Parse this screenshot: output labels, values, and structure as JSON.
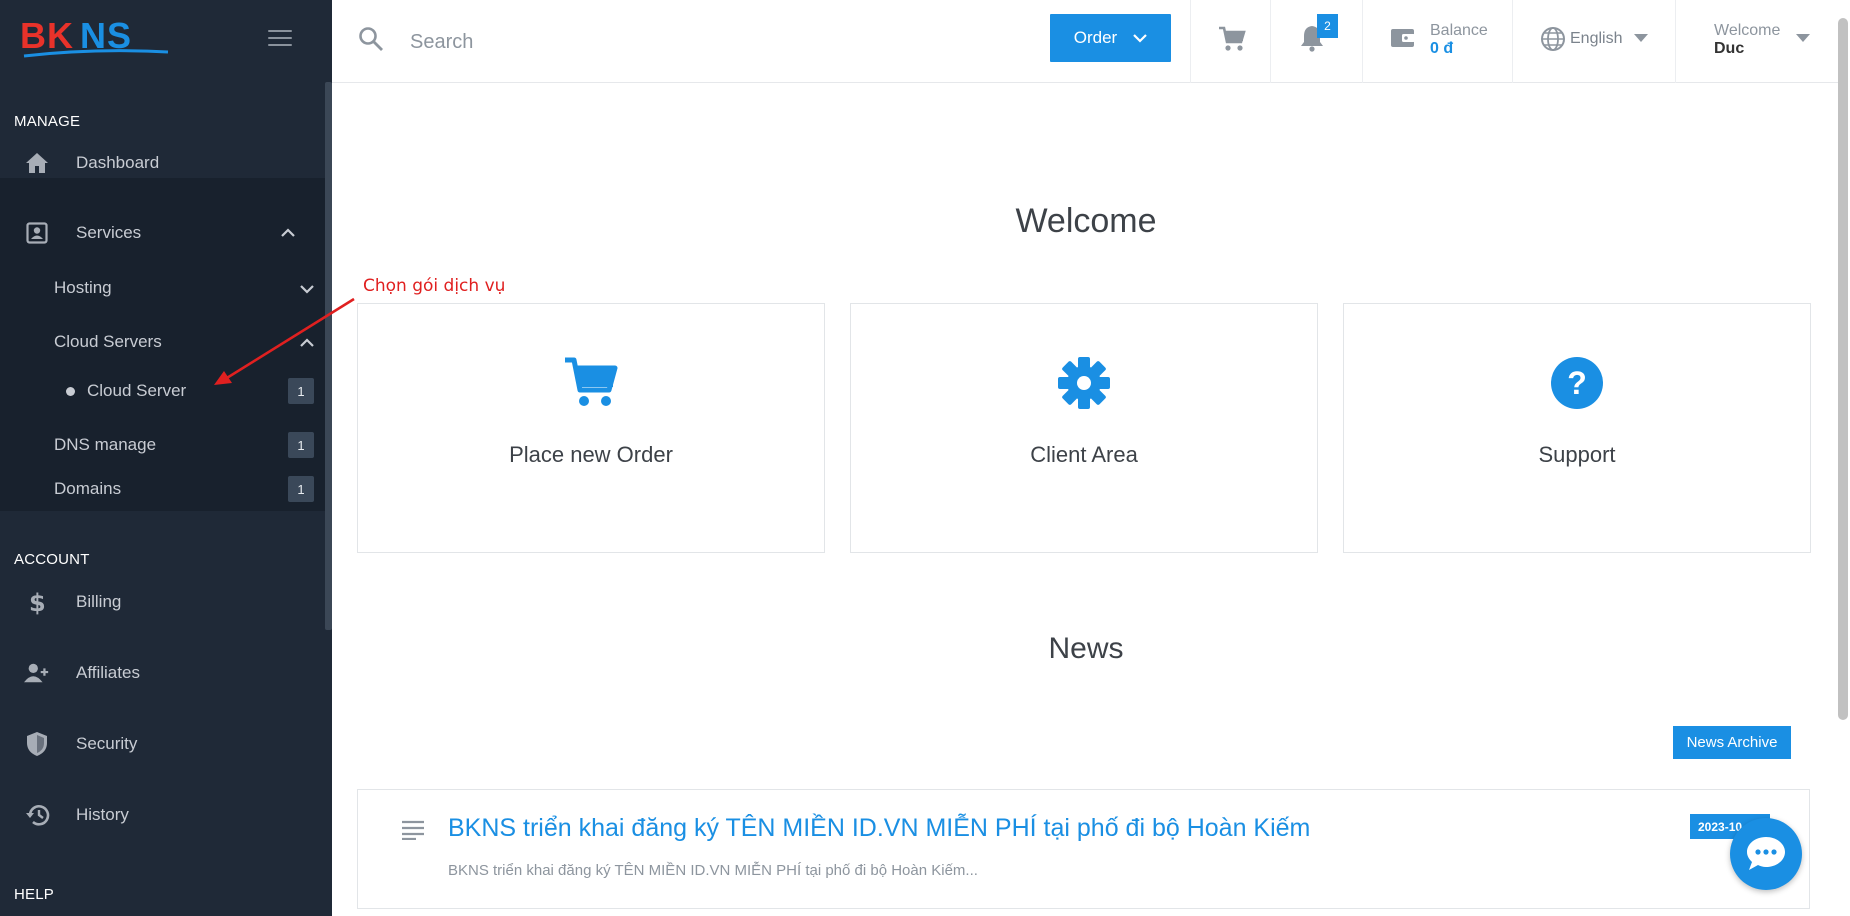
{
  "brand": {
    "logo_text": "BKNS"
  },
  "sidebar": {
    "sections": {
      "manage": "MANAGE",
      "account": "ACCOUNT",
      "help": "HELP"
    },
    "manage_items": {
      "dashboard": "Dashboard",
      "services": "Services"
    },
    "services_sub": {
      "hosting": "Hosting",
      "cloud_servers": "Cloud Servers",
      "cloud_server": "Cloud Server",
      "cloud_server_count": "1",
      "dns_manage": "DNS manage",
      "dns_manage_count": "1",
      "domains": "Domains",
      "domains_count": "1"
    },
    "account_items": {
      "billing": "Billing",
      "affiliates": "Affiliates",
      "security": "Security",
      "history": "History"
    }
  },
  "topbar": {
    "search_placeholder": "Search",
    "order_label": "Order",
    "notification_count": "2",
    "balance_label": "Balance",
    "balance_value": "0 đ",
    "language": "English",
    "welcome_label": "Welcome",
    "user_name": "Duc"
  },
  "main": {
    "welcome_heading": "Welcome",
    "cards": {
      "order": "Place new Order",
      "client_area": "Client Area",
      "support": "Support"
    },
    "news_heading": "News",
    "news_archive_label": "News Archive",
    "news_item": {
      "title": "BKNS triển khai đăng ký TÊN MIỀN ID.VN MIỄN PHÍ tại phố đi bộ Hoàn Kiếm",
      "excerpt": "BKNS triển khai đăng ký TÊN MIỀN ID.VN MIỄN PHÍ tại phố đi bộ Hoàn Kiếm...",
      "date": "2023-10-"
    }
  },
  "annotation": {
    "text": "Chọn gói dịch vụ"
  },
  "colors": {
    "accent": "#1a8fe3",
    "sidebar_bg": "#1f2937",
    "annotation": "#e02020"
  }
}
